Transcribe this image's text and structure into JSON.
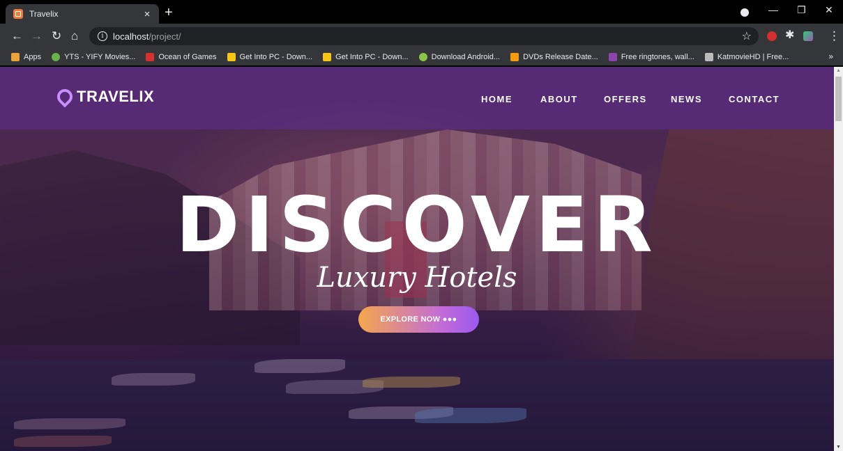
{
  "browser": {
    "tab_title": "Travelix",
    "tab_close": "×",
    "new_tab": "+",
    "url_host": "localhost",
    "url_path": "/project/",
    "window_controls": {
      "minimize": "—",
      "restore": "❐",
      "close": "✕"
    }
  },
  "bookmarks": {
    "items": [
      {
        "label": "Apps",
        "icon": "apps-grid-icon",
        "color": "#e8a33d"
      },
      {
        "label": "YTS - YIFY Movies...",
        "icon": "yts-icon",
        "color": "#6ab04c"
      },
      {
        "label": "Ocean of Games",
        "icon": "ocean-games-icon",
        "color": "#d63031"
      },
      {
        "label": "Get Into PC - Down...",
        "icon": "getintopc-icon",
        "color": "#f5c518"
      },
      {
        "label": "Get Into PC - Down...",
        "icon": "getintopc-icon",
        "color": "#f5c518"
      },
      {
        "label": "Download Android...",
        "icon": "android-icon",
        "color": "#8bc34a"
      },
      {
        "label": "DVDs Release Date...",
        "icon": "dvd-icon",
        "color": "#f39c12"
      },
      {
        "label": "Free ringtones, wall...",
        "icon": "ringtones-icon",
        "color": "#8e44ad"
      },
      {
        "label": "KatmovieHD | Free...",
        "icon": "katmovie-icon",
        "color": "#bbbbbb"
      }
    ],
    "more": "»"
  },
  "site": {
    "logo": "TRAVELIX",
    "nav": [
      "HOME",
      "ABOUT",
      "OFFERS",
      "NEWS",
      "CONTACT"
    ],
    "hero_title": "DISCOVER",
    "hero_subtitle": "Luxury Hotels",
    "cta": "EXPLORE NOW ●●●"
  },
  "colors": {
    "header_overlay": "#5c2c82",
    "cta_start": "#f4a64e",
    "cta_end": "#9b59f0",
    "logo_pin": "#c98fff"
  }
}
